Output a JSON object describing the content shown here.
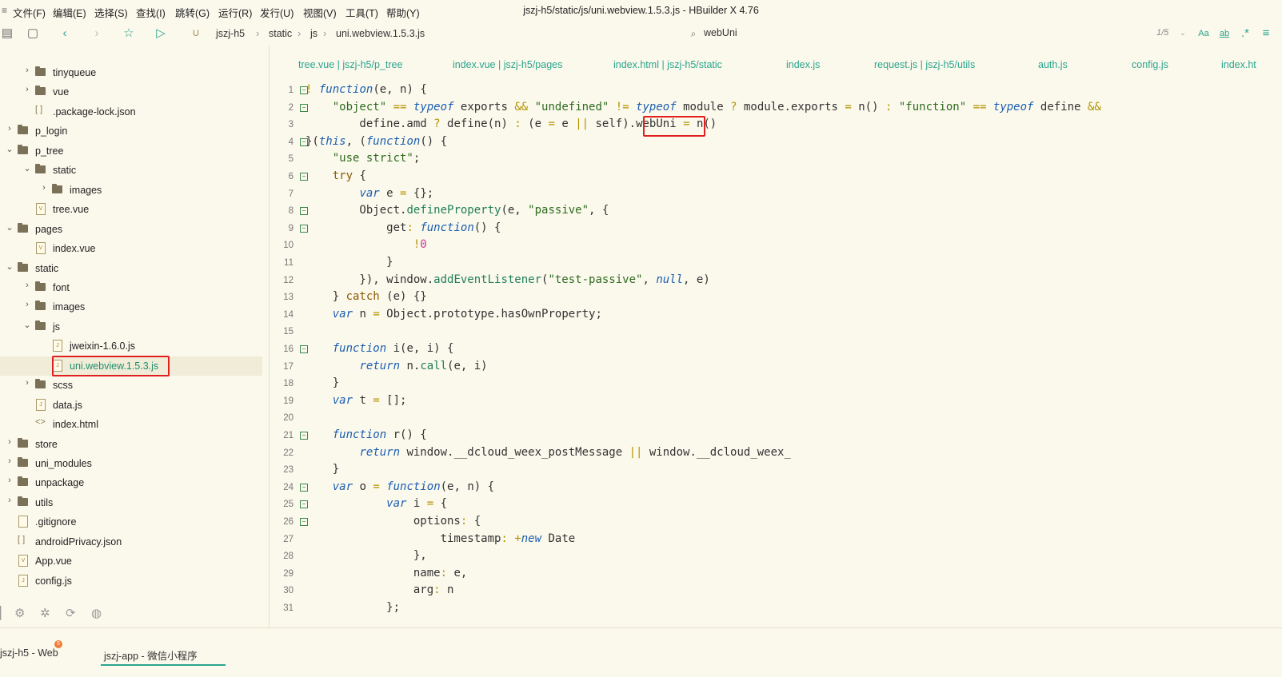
{
  "menubar": {
    "items": [
      "文件(F)",
      "编辑(E)",
      "选择(S)",
      "查找(I)",
      "跳转(G)",
      "运行(R)",
      "发行(U)",
      "视图(V)",
      "工具(T)",
      "帮助(Y)"
    ],
    "title": "jszj-h5/static/js/uni.webview.1.5.3.js - HBuilder X 4.76"
  },
  "toolbar": {
    "breadcrumb": [
      "jszj-h5",
      "static",
      "js",
      "uni.webview.1.5.3.js"
    ],
    "search": "webUni",
    "search_count": "1/5"
  },
  "sidebar": {
    "items": [
      {
        "label": "tinyqueue",
        "type": "folder",
        "level": 1,
        "expanded": false
      },
      {
        "label": "vue",
        "type": "folder",
        "level": 1,
        "expanded": false
      },
      {
        "label": ".package-lock.json",
        "type": "json",
        "level": 1
      },
      {
        "label": "p_login",
        "type": "folder",
        "level": 0,
        "expanded": false
      },
      {
        "label": "p_tree",
        "type": "folder",
        "level": 0,
        "expanded": true
      },
      {
        "label": "static",
        "type": "folder",
        "level": 1,
        "expanded": true
      },
      {
        "label": "images",
        "type": "folder",
        "level": 2,
        "expanded": false
      },
      {
        "label": "tree.vue",
        "type": "vue",
        "level": 1
      },
      {
        "label": "pages",
        "type": "folder",
        "level": 0,
        "expanded": true
      },
      {
        "label": "index.vue",
        "type": "vue",
        "level": 1
      },
      {
        "label": "static",
        "type": "folder",
        "level": 0,
        "expanded": true
      },
      {
        "label": "font",
        "type": "folder",
        "level": 1,
        "expanded": false
      },
      {
        "label": "images",
        "type": "folder",
        "level": 1,
        "expanded": false
      },
      {
        "label": "js",
        "type": "folder",
        "level": 1,
        "expanded": true
      },
      {
        "label": "jweixin-1.6.0.js",
        "type": "js",
        "level": 2
      },
      {
        "label": "uni.webview.1.5.3.js",
        "type": "js",
        "level": 2,
        "selected": true
      },
      {
        "label": "scss",
        "type": "folder",
        "level": 1,
        "expanded": false
      },
      {
        "label": "data.js",
        "type": "js",
        "level": 1
      },
      {
        "label": "index.html",
        "type": "html",
        "level": 1
      },
      {
        "label": "store",
        "type": "folder",
        "level": 0,
        "expanded": false
      },
      {
        "label": "uni_modules",
        "type": "folder",
        "level": 0,
        "expanded": false
      },
      {
        "label": "unpackage",
        "type": "folder",
        "level": 0,
        "expanded": false
      },
      {
        "label": "utils",
        "type": "folder",
        "level": 0,
        "expanded": false
      },
      {
        "label": ".gitignore",
        "type": "file",
        "level": 0
      },
      {
        "label": "androidPrivacy.json",
        "type": "json",
        "level": 0
      },
      {
        "label": "App.vue",
        "type": "vue",
        "level": 0
      },
      {
        "label": "config.js",
        "type": "js",
        "level": 0
      }
    ]
  },
  "tabs": [
    "tree.vue | jszj-h5/p_tree",
    "index.vue | jszj-h5/pages",
    "index.html | jszj-h5/static",
    "index.js",
    "request.js | jszj-h5/utils",
    "auth.js",
    "config.js",
    "index.ht"
  ],
  "code": {
    "lines": [
      {
        "n": "1",
        "text": "! function(e, n) {",
        "fold": true
      },
      {
        "n": "2",
        "text": "    \"object\" == typeof exports && \"undefined\" != typeof module ? module.exports = n() : \"function\" == typeof define &&",
        "fold": true
      },
      {
        "n": "3",
        "text": "        define.amd ? define(n) : (e = e || self).webUni = n()",
        "fold": false
      },
      {
        "n": "4",
        "text": "}(this, (function() {",
        "fold": true
      },
      {
        "n": "5",
        "text": "    \"use strict\";",
        "fold": false
      },
      {
        "n": "6",
        "text": "    try {",
        "fold": true
      },
      {
        "n": "7",
        "text": "        var e = {};",
        "fold": false
      },
      {
        "n": "8",
        "text": "        Object.defineProperty(e, \"passive\", {",
        "fold": true
      },
      {
        "n": "9",
        "text": "            get: function() {",
        "fold": true
      },
      {
        "n": "10",
        "text": "                !0",
        "fold": false
      },
      {
        "n": "11",
        "text": "            }",
        "fold": false
      },
      {
        "n": "12",
        "text": "        }), window.addEventListener(\"test-passive\", null, e)",
        "fold": false
      },
      {
        "n": "13",
        "text": "    } catch (e) {}",
        "fold": false
      },
      {
        "n": "14",
        "text": "    var n = Object.prototype.hasOwnProperty;",
        "fold": false
      },
      {
        "n": "15",
        "text": "",
        "fold": false
      },
      {
        "n": "16",
        "text": "    function i(e, i) {",
        "fold": true
      },
      {
        "n": "17",
        "text": "        return n.call(e, i)",
        "fold": false
      },
      {
        "n": "18",
        "text": "    }",
        "fold": false
      },
      {
        "n": "19",
        "text": "    var t = [];",
        "fold": false
      },
      {
        "n": "20",
        "text": "",
        "fold": false
      },
      {
        "n": "21",
        "text": "    function r() {",
        "fold": true
      },
      {
        "n": "22",
        "text": "        return window.__dcloud_weex_postMessage || window.__dcloud_weex_",
        "fold": false
      },
      {
        "n": "23",
        "text": "    }",
        "fold": false
      },
      {
        "n": "24",
        "text": "    var o = function(e, n) {",
        "fold": true
      },
      {
        "n": "25",
        "text": "            var i = {",
        "fold": true
      },
      {
        "n": "26",
        "text": "                options: {",
        "fold": true
      },
      {
        "n": "27",
        "text": "                    timestamp: +new Date",
        "fold": false
      },
      {
        "n": "28",
        "text": "                },",
        "fold": false
      },
      {
        "n": "29",
        "text": "                name: e,",
        "fold": false
      },
      {
        "n": "30",
        "text": "                arg: n",
        "fold": false
      },
      {
        "n": "31",
        "text": "            };",
        "fold": false
      }
    ]
  },
  "bottom_tabs": [
    {
      "label": "jszj-h5 - Web",
      "badge": "5"
    },
    {
      "label": "jszj-app - 微信小程序",
      "active": true
    }
  ],
  "colors": {
    "accent": "#2aa58e",
    "highlight_box": "#e0201e",
    "background": "#fbf8ec"
  }
}
